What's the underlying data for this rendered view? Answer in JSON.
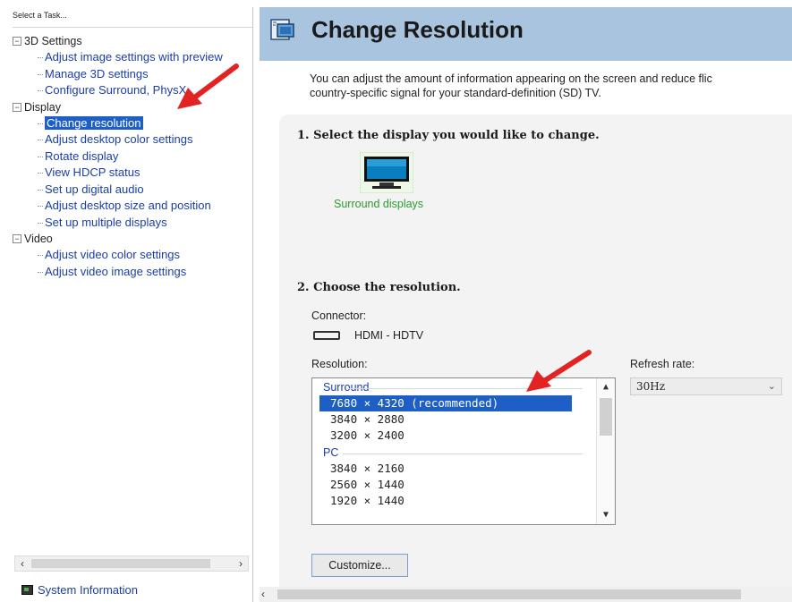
{
  "sidebar": {
    "task_label": "Select a Task...",
    "categories": [
      {
        "name": "3D Settings",
        "toggle": "−",
        "items": [
          "Adjust image settings with preview",
          "Manage 3D settings",
          "Configure Surround, PhysX"
        ]
      },
      {
        "name": "Display",
        "toggle": "−",
        "items": [
          "Change resolution",
          "Adjust desktop color settings",
          "Rotate display",
          "View HDCP status",
          "Set up digital audio",
          "Adjust desktop size and position",
          "Set up multiple displays"
        ]
      },
      {
        "name": "Video",
        "toggle": "−",
        "items": [
          "Adjust video color settings",
          "Adjust video image settings"
        ]
      }
    ],
    "selected_item": "Change resolution",
    "system_info": "System Information"
  },
  "main": {
    "title": "Change Resolution",
    "desc_line1": "You can adjust the amount of information appearing on the screen and reduce flic",
    "desc_line2": "country-specific signal for your standard-definition (SD) TV.",
    "step1": "1. Select the display you would like to change.",
    "display_name": "Surround displays",
    "step2": "2. Choose the resolution.",
    "connector_label": "Connector:",
    "connector_value": "HDMI - HDTV",
    "resolution_label": "Resolution:",
    "refresh_label": "Refresh rate:",
    "refresh_value": "30Hz",
    "resolution_groups": [
      {
        "name": "Surround",
        "options": [
          "7680 × 4320 (recommended)",
          "3840 × 2880",
          "3200 × 2400"
        ]
      },
      {
        "name": "PC",
        "options": [
          "3840 × 2160",
          "2560 × 1440",
          "1920 × 1440"
        ]
      }
    ],
    "selected_resolution": "7680 × 4320 (recommended)",
    "customize_label": "Customize..."
  },
  "colors": {
    "header_bg": "#a9c4df",
    "selection": "#1d5fc4",
    "link": "#1a3ea8",
    "display_label": "#2e9a2e",
    "annotation_arrow": "#e32222"
  }
}
